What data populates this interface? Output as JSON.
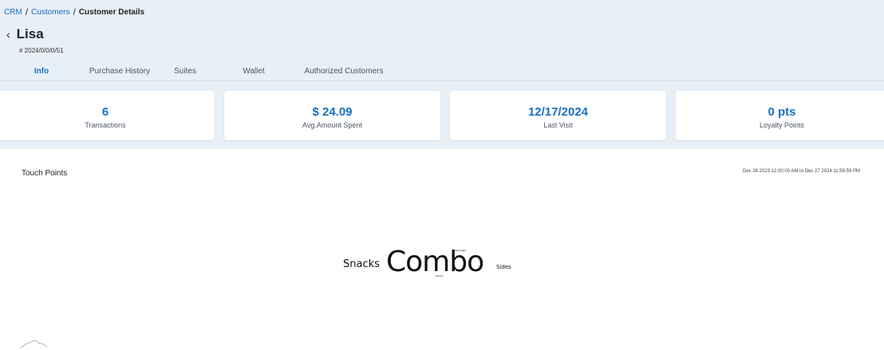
{
  "breadcrumb": {
    "items": [
      "CRM",
      "Customers",
      "Customer Details"
    ],
    "separator": "/"
  },
  "customer": {
    "name": "Lisa",
    "id": "# 2024/0/0/0/51"
  },
  "tabs": [
    {
      "label": "Info",
      "active": true
    },
    {
      "label": "Purchase History"
    },
    {
      "label": "Suites"
    },
    {
      "label": "Wallet"
    },
    {
      "label": "Authorized Customers"
    }
  ],
  "stats": [
    {
      "value": "6",
      "label": "Transactions"
    },
    {
      "value": "$ 24.09",
      "label": "Avg.Amount Spent"
    },
    {
      "value": "12/17/2024",
      "label": "Last Visit"
    },
    {
      "value": "0 pts",
      "label": "Loyalty Points"
    }
  ],
  "touch_points": {
    "title": "Touch Points",
    "date_range": "Dec 28 2023 12:00:00 AM to Dec 27 2024 11:59:59 PM",
    "words": [
      "Snacks",
      "Combo",
      "Sides",
      "Beverages",
      "Drinks"
    ]
  },
  "colors": {
    "accent": "#1b6fc2",
    "header_bg": "#e8eff7"
  },
  "icons": {
    "back": "arrow-left-icon",
    "footer": "cloud-outline-icon"
  }
}
